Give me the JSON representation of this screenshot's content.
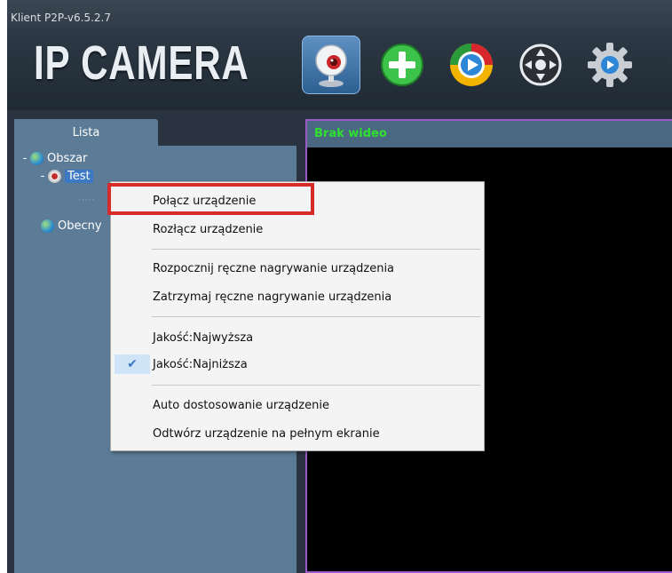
{
  "window": {
    "title": "Klient P2P-v6.5.2.7"
  },
  "toolbar": {
    "logo": "IP CAMERA",
    "buttons": [
      {
        "icon": "webcam-icon",
        "active": true
      },
      {
        "icon": "add-icon"
      },
      {
        "icon": "play-icon"
      },
      {
        "icon": "ptz-control-icon"
      },
      {
        "icon": "settings-icon"
      }
    ]
  },
  "sidebar": {
    "tab_label": "Lista",
    "tree": {
      "area": {
        "toggle": "-",
        "label": "Obszar"
      },
      "device": {
        "toggle": "-",
        "label": "Test"
      },
      "online": {
        "label": "Obecny"
      }
    }
  },
  "video": {
    "status": "Brak wideo"
  },
  "context_menu": {
    "groups": [
      [
        {
          "label": "Połącz urządzenie",
          "checked": false,
          "highlighted": true
        },
        {
          "label": "Rozłącz urządzenie",
          "checked": false
        }
      ],
      [
        {
          "label": "Rozpocznij ręczne nagrywanie urządzenia",
          "checked": false
        },
        {
          "label": "Zatrzymaj ręczne nagrywanie urządzenia",
          "checked": false
        }
      ],
      [
        {
          "label": "Jakość:Najwyższa",
          "checked": false
        },
        {
          "label": "Jakość:Najniższa",
          "checked": true
        }
      ],
      [
        {
          "label": "Auto dostosowanie urządzenie",
          "checked": false
        },
        {
          "label": "Odtwórz urządzenie na pełnym ekranie",
          "checked": false
        }
      ]
    ],
    "check_glyph": "✔"
  },
  "colors": {
    "highlight_border": "#d52b2b",
    "video_status": "#2fe02f",
    "sidebar_bg": "#5b7b96",
    "video_border": "#9b58c7"
  }
}
